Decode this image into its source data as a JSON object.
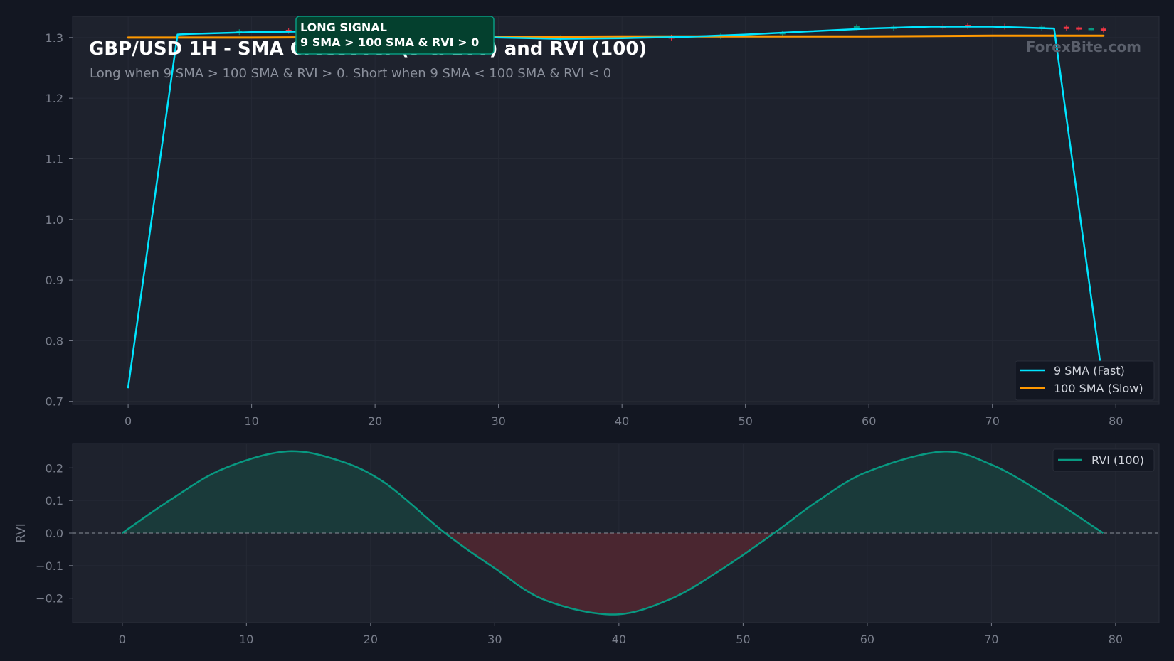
{
  "title": "GBP/USD 1H - SMA Crossover (9 & 100) and RVI (100)",
  "subtitle": "Long when 9 SMA > 100 SMA & RVI > 0. Short when 9 SMA < 100 SMA & RVI < 0",
  "watermark": "ForexBite.com",
  "annotation": {
    "line1": "LONG SIGNAL",
    "line2": "9 SMA > 100 SMA & RVI > 0"
  },
  "colors": {
    "background": "#131722",
    "panel": "#1e222d",
    "fast_sma": "#00e5ff",
    "slow_sma": "#ff9800",
    "rvi": "#089981",
    "rvi_pos_fill": "#1a3a3a",
    "rvi_neg_fill": "#4a2630",
    "annotation_bg": "#04402e",
    "annotation_border": "#089981",
    "bull_candle": "#089981",
    "bear_candle": "#f23645"
  },
  "chart_data": [
    {
      "type": "line",
      "title": "GBP/USD 1H - SMA Crossover (9 & 100) and RVI (100)",
      "subtitle": "Long when 9 SMA > 100 SMA & RVI > 0. Short when 9 SMA < 100 SMA & RVI < 0",
      "xlabel": "",
      "ylabel": "",
      "xlim": [
        -4.5,
        83.5
      ],
      "ylim": [
        0.695,
        1.335
      ],
      "xticks": [
        0,
        10,
        20,
        30,
        40,
        50,
        60,
        70,
        80
      ],
      "yticks": [
        0.7,
        0.8,
        0.9,
        1.0,
        1.1,
        1.2,
        1.3
      ],
      "grid": true,
      "legend": "bottom-right",
      "series": [
        {
          "name": "9 SMA (Fast)",
          "color": "#00e5ff",
          "x": [
            0,
            4,
            5,
            10,
            15,
            20,
            25,
            30,
            35,
            40,
            45,
            50,
            55,
            60,
            65,
            70,
            75,
            79
          ],
          "y": [
            0.723,
            1.305,
            1.306,
            1.309,
            1.31,
            1.308,
            1.304,
            1.3,
            1.298,
            1.299,
            1.301,
            1.305,
            1.31,
            1.315,
            1.318,
            1.318,
            1.315,
            0.725
          ]
        },
        {
          "name": "100 SMA (Slow)",
          "color": "#ff9800",
          "x": [
            0,
            10,
            20,
            30,
            40,
            50,
            60,
            70,
            79
          ],
          "y": [
            1.3,
            1.3,
            1.301,
            1.301,
            1.302,
            1.302,
            1.302,
            1.303,
            1.303
          ]
        }
      ],
      "candles": {
        "bull_color": "#089981",
        "bear_color": "#f23645",
        "x": [
          9,
          13,
          25,
          35,
          44,
          48,
          53,
          59,
          62,
          66,
          68,
          71,
          74,
          76,
          77,
          78,
          79
        ],
        "close": [
          1.309,
          1.311,
          1.305,
          1.299,
          1.3,
          1.302,
          1.307,
          1.317,
          1.316,
          1.318,
          1.319,
          1.318,
          1.316,
          1.316,
          1.315,
          1.314,
          1.313
        ],
        "direction": [
          "up",
          "down",
          "up",
          "up",
          "down",
          "up",
          "up",
          "up",
          "up",
          "down",
          "down",
          "down",
          "up",
          "down",
          "down",
          "up",
          "down"
        ]
      }
    },
    {
      "type": "area",
      "title": "",
      "xlabel": "",
      "ylabel": "RVI",
      "xlim": [
        -4,
        83.5
      ],
      "ylim": [
        -0.275,
        0.275
      ],
      "xticks": [
        0,
        10,
        20,
        30,
        40,
        50,
        60,
        70,
        80
      ],
      "yticks": [
        0.2,
        0.1,
        0.0,
        -0.1,
        -0.2
      ],
      "ytick_labels": [
        "0.2",
        "0.1",
        "0.0",
        "−0.1",
        "−0.2"
      ],
      "grid": true,
      "legend": "top-right",
      "zero_line": true,
      "series": [
        {
          "name": "RVI (100)",
          "color": "#089981",
          "x": [
            0,
            4,
            8,
            13,
            17,
            21,
            26,
            30,
            34,
            39.5,
            44,
            48,
            52.5,
            56,
            60,
            66,
            70,
            74,
            79
          ],
          "y": [
            0.0,
            0.105,
            0.195,
            0.25,
            0.228,
            0.158,
            0.0,
            -0.108,
            -0.205,
            -0.25,
            -0.205,
            -0.118,
            0.0,
            0.098,
            0.188,
            0.25,
            0.21,
            0.125,
            0.0
          ]
        }
      ]
    }
  ]
}
